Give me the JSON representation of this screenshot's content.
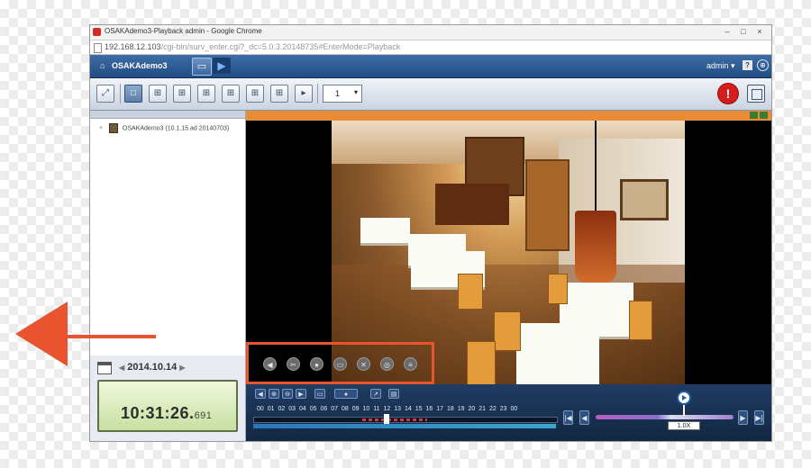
{
  "window": {
    "title": "OSAKAdemo3-Playback admin - Google Chrome",
    "controls": [
      "–",
      "□",
      "×"
    ]
  },
  "address": {
    "host": "192.168.12.103",
    "path": "/cgi-bin/surv_enter.cgi?_dc=5.0.3.20148735#EnterMode=Playback"
  },
  "app": {
    "home_icon": "home-icon",
    "site_name": "OSAKAdemo3",
    "user": "admin",
    "user_menu_arrow": "▾",
    "help_label": "?",
    "language_icon": "globe-icon"
  },
  "toolbar": {
    "channel_select": "1",
    "select_arrow": "▾",
    "alarm_label": "!"
  },
  "tree": {
    "expander": "+",
    "root_label": "OSAKAdemo3 (10.1.15.ad 20140703)"
  },
  "datetime": {
    "date_prev": "◀",
    "date": "2014.10.14",
    "date_next": "▶",
    "time": "10:31:26.",
    "ms": "691"
  },
  "video_controls": [
    {
      "name": "audio-icon",
      "glyph": "◀"
    },
    {
      "name": "cut-icon",
      "glyph": "✂"
    },
    {
      "name": "snapshot-icon",
      "glyph": "●"
    },
    {
      "name": "camera-icon",
      "glyph": "▭"
    },
    {
      "name": "expand-icon",
      "glyph": "✕"
    },
    {
      "name": "zoom-icon",
      "glyph": "◎"
    },
    {
      "name": "info-icon",
      "glyph": "≡"
    }
  ],
  "timeline": {
    "buttons": [
      "◀",
      "⊕",
      "⊖",
      "▶",
      "▭",
      "●",
      "↗",
      "▤"
    ],
    "hours": [
      "00",
      "01",
      "02",
      "03",
      "04",
      "05",
      "06",
      "07",
      "08",
      "09",
      "10",
      "11",
      "12",
      "13",
      "14",
      "15",
      "16",
      "17",
      "18",
      "19",
      "20",
      "21",
      "22",
      "23",
      "00"
    ],
    "speed": "1.0X",
    "nav_first": "|◀",
    "nav_prev": "◀",
    "nav_next": "▶",
    "nav_last": "▶|"
  }
}
